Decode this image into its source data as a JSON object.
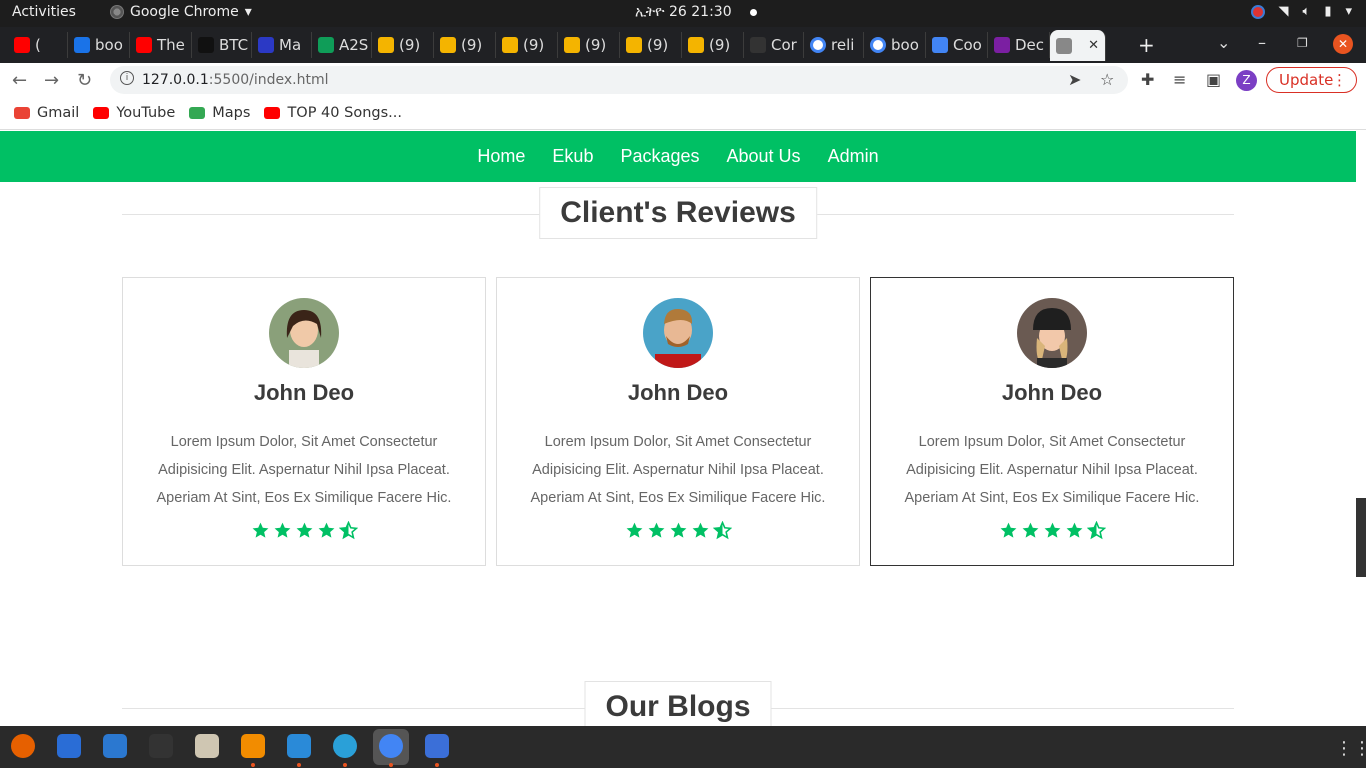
{
  "system": {
    "activities": "Activities",
    "app_name": "Google Chrome",
    "clock": "ኢትዮ 26  21:30"
  },
  "browser": {
    "tabs": [
      {
        "label": "(",
        "color": "#ff0000"
      },
      {
        "label": "boo",
        "color": "#1a73e8"
      },
      {
        "label": "The",
        "color": "#ff0000"
      },
      {
        "label": "BTC",
        "color": "#111111"
      },
      {
        "label": "Ma",
        "color": "#2b39c5"
      },
      {
        "label": "A2S",
        "color": "#0f9d58"
      },
      {
        "label": "(9)",
        "color": "#f4b400"
      },
      {
        "label": "(9)",
        "color": "#f4b400"
      },
      {
        "label": "(9)",
        "color": "#f4b400"
      },
      {
        "label": "(9)",
        "color": "#f4b400"
      },
      {
        "label": "(9)",
        "color": "#f4b400"
      },
      {
        "label": "(9)",
        "color": "#f4b400"
      },
      {
        "label": "Cor",
        "color": "#333333"
      },
      {
        "label": "reli",
        "color": "#ffffff"
      },
      {
        "label": "boo",
        "color": "#ffffff"
      },
      {
        "label": "Coo",
        "color": "#4285f4"
      },
      {
        "label": "Dec",
        "color": "#7b1fa2"
      },
      {
        "label": "",
        "color": "#888888"
      }
    ],
    "new_tab": "+",
    "url_host": "127.0.0.1",
    "url_rest": ":5500/index.html",
    "avatar_letter": "Z",
    "update_label": "Update",
    "bookmarks": [
      {
        "label": "Gmail",
        "color": "#ea4335"
      },
      {
        "label": "YouTube",
        "color": "#ff0000"
      },
      {
        "label": "Maps",
        "color": "#34a853"
      },
      {
        "label": "TOP 40 Songs...",
        "color": "#ff0000"
      }
    ]
  },
  "site": {
    "nav": [
      "Home",
      "Ekub",
      "Packages",
      "About Us",
      "Admin"
    ],
    "accent": "#00c064",
    "reviews_heading": "Client's Reviews",
    "blogs_heading": "Our Blogs",
    "reviews": [
      {
        "name": "John Deo",
        "text": "Lorem Ipsum Dolor, Sit Amet Consectetur Adipisicing Elit. Aspernatur Nihil Ipsa Placeat. Aperiam At Sint, Eos Ex Similique Facere Hic.",
        "rating": 4.5
      },
      {
        "name": "John Deo",
        "text": "Lorem Ipsum Dolor, Sit Amet Consectetur Adipisicing Elit. Aspernatur Nihil Ipsa Placeat. Aperiam At Sint, Eos Ex Similique Facere Hic.",
        "rating": 4.5
      },
      {
        "name": "John Deo",
        "text": "Lorem Ipsum Dolor, Sit Amet Consectetur Adipisicing Elit. Aspernatur Nihil Ipsa Placeat. Aperiam At Sint, Eos Ex Similique Facere Hic.",
        "rating": 4.5
      }
    ]
  },
  "dock": {
    "apps": [
      "firefox-icon",
      "thunderbird-icon",
      "libreoffice-writer-icon",
      "terminal-icon",
      "files-icon",
      "vlc-icon",
      "vscode-icon",
      "telegram-icon",
      "chrome-icon",
      "text-editor-icon"
    ]
  }
}
